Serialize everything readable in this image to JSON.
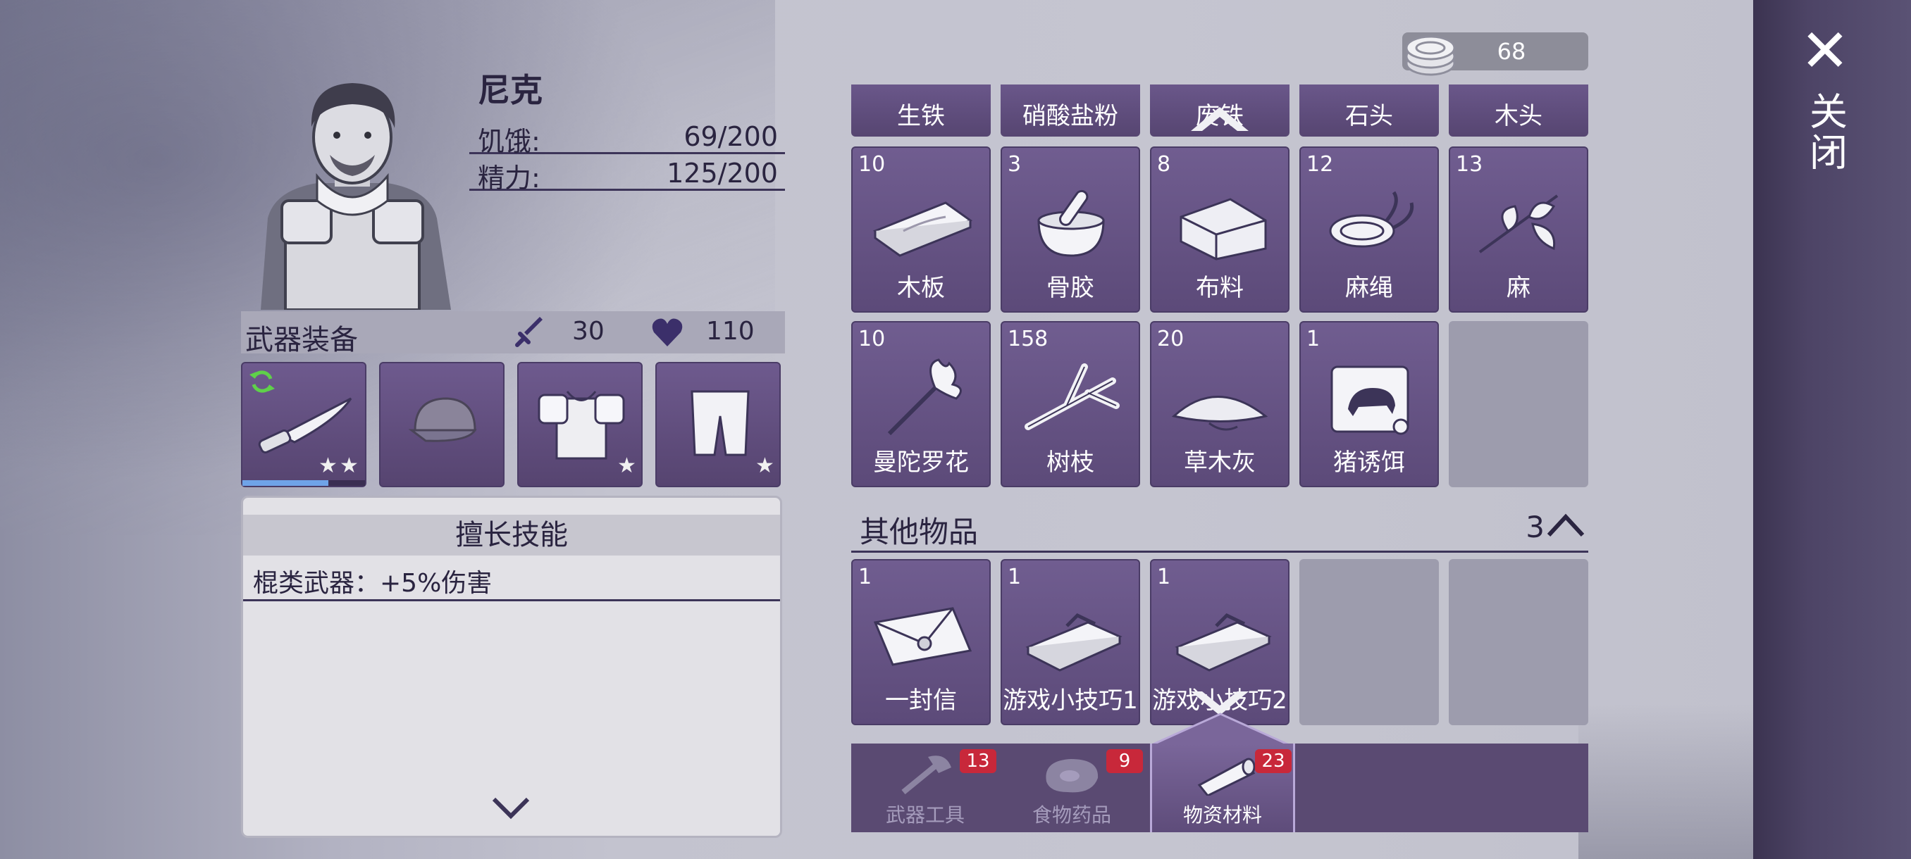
{
  "close": {
    "label": "关闭"
  },
  "currency": {
    "amount": "68"
  },
  "character": {
    "name": "尼克",
    "hunger_label": "饥饿:",
    "hunger_value": "69/200",
    "energy_label": "精力:",
    "energy_value": "125/200"
  },
  "equipment": {
    "title": "武器装备",
    "attack": "30",
    "health": "110",
    "weapon_durability_fraction": 0.7,
    "slots": [
      {
        "name": "knife",
        "stars": 2
      },
      {
        "name": "cap",
        "stars": 0
      },
      {
        "name": "armor",
        "stars": 1
      },
      {
        "name": "pants",
        "stars": 1
      }
    ]
  },
  "skills": {
    "title": "擅长技能",
    "line": "棍类武器：+5%伤害"
  },
  "material_tabs": [
    "生铁",
    "硝酸盐粉",
    "废铁",
    "石头",
    "木头"
  ],
  "materials": [
    {
      "qty": "10",
      "name": "木板",
      "icon": "plank-icon"
    },
    {
      "qty": "3",
      "name": "骨胶",
      "icon": "mortar-icon"
    },
    {
      "qty": "8",
      "name": "布料",
      "icon": "cloth-icon"
    },
    {
      "qty": "12",
      "name": "麻绳",
      "icon": "rope-icon"
    },
    {
      "qty": "13",
      "name": "麻",
      "icon": "hemp-icon"
    },
    {
      "qty": "10",
      "name": "曼陀罗花",
      "icon": "datura-icon"
    },
    {
      "qty": "158",
      "name": "树枝",
      "icon": "branch-icon"
    },
    {
      "qty": "20",
      "name": "草木灰",
      "icon": "ash-icon"
    },
    {
      "qty": "1",
      "name": "猪诱饵",
      "icon": "bait-icon"
    }
  ],
  "other": {
    "title": "其他物品",
    "count": "3",
    "items": [
      {
        "qty": "1",
        "name": "一封信",
        "icon": "letter-icon"
      },
      {
        "qty": "1",
        "name": "游戏小技巧1",
        "icon": "book-icon"
      },
      {
        "qty": "1",
        "name": "游戏小技巧2",
        "icon": "book-icon"
      }
    ]
  },
  "tabs": [
    {
      "label": "武器工具",
      "badge": "13"
    },
    {
      "label": "食物药品",
      "badge": "9"
    },
    {
      "label": "物资材料",
      "badge": "23",
      "active": true
    }
  ],
  "colors": {
    "badge": "#c8283a",
    "cell": "#5c4a79",
    "side_bar": "#4d4466"
  }
}
